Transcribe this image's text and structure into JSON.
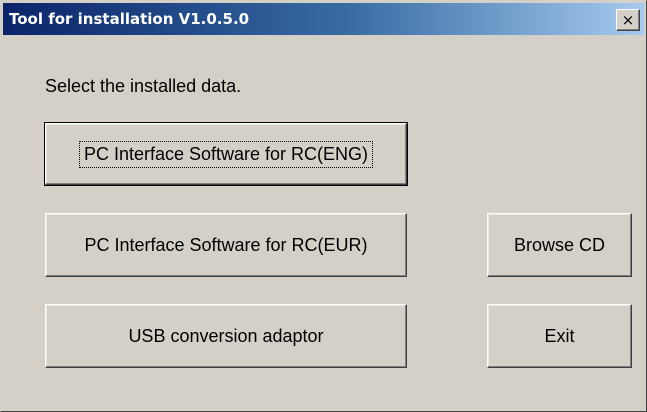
{
  "window": {
    "title": "Tool for installation V1.0.5.0",
    "close_glyph": "×",
    "close_icon": "close-icon"
  },
  "main": {
    "prompt": "Select the installed data.",
    "buttons": {
      "pc_eng": "PC Interface Software for RC(ENG)",
      "pc_eur": "PC Interface Software for RC(EUR)",
      "usb": "USB conversion adaptor",
      "browse_cd": "Browse CD",
      "exit": "Exit"
    }
  },
  "colors": {
    "dialog_bg": "#d4d0c8",
    "titlebar_start": "#0a246a",
    "titlebar_end": "#a6caf0"
  }
}
